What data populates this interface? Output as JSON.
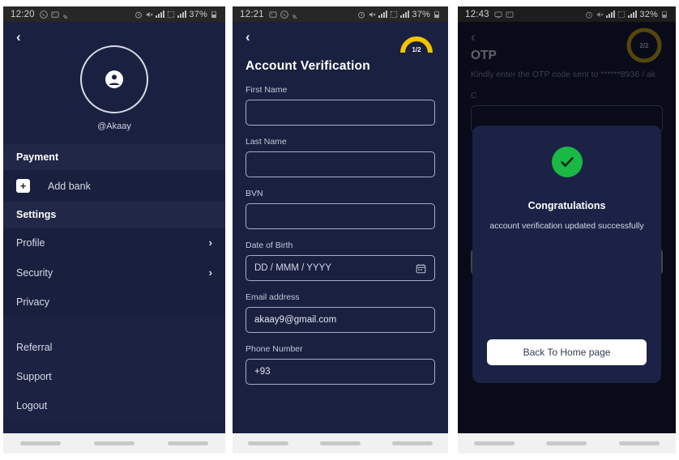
{
  "phone1": {
    "status": {
      "time": "12:20",
      "battery": "37%",
      "left_icons": [
        "whatsapp-icon",
        "image-icon",
        "cast-icon"
      ],
      "right_icons": [
        "alarm-icon",
        "mute-icon",
        "signal-icon",
        "sim-icon",
        "signal-icon"
      ]
    },
    "back_label": "‹",
    "profile": {
      "handle": "@Akaay",
      "avatar_icon": "person-icon"
    },
    "sections": [
      {
        "title": "Payment",
        "items": [
          {
            "label": "Add bank",
            "icon": "plus-icon",
            "chevron": false
          }
        ]
      },
      {
        "title": "Settings",
        "items": [
          {
            "label": "Profile",
            "chevron": true
          },
          {
            "label": "Security",
            "chevron": true
          },
          {
            "label": "Privacy",
            "chevron": false
          }
        ]
      }
    ],
    "footer_items": [
      {
        "label": "Referral"
      },
      {
        "label": "Support"
      },
      {
        "label": "Logout"
      }
    ]
  },
  "phone2": {
    "status": {
      "time": "12:21",
      "battery": "37%"
    },
    "back_label": "‹",
    "progress": {
      "label": "1/2",
      "color": "#f2c300",
      "percent": 50
    },
    "title": "Account Verification",
    "fields": [
      {
        "label": "First Name",
        "value": "",
        "placeholder": ""
      },
      {
        "label": "Last Name",
        "value": "",
        "placeholder": ""
      },
      {
        "label": "BVN",
        "value": "",
        "placeholder": ""
      },
      {
        "label": "Date of Birth",
        "value": "",
        "placeholder": "DD / MMM / YYYY",
        "icon": "calendar-icon"
      },
      {
        "label": "Email address",
        "value": "akaay9@gmail.com",
        "placeholder": ""
      },
      {
        "label": "Phone Number",
        "value": "+93",
        "placeholder": ""
      }
    ]
  },
  "phone3": {
    "status": {
      "time": "12:43",
      "battery": "32%"
    },
    "back_label": "‹",
    "progress": {
      "label": "2/2",
      "color": "#d4aa06",
      "percent": 100
    },
    "title": "OTP",
    "description": "Kindly enter the OTP code sent to ******8936 / ak",
    "sub_label": "C",
    "modal": {
      "icon": "success-check-icon",
      "icon_color": "#1ab845",
      "title": "Congratulations",
      "message": "account verification updated successfully",
      "button_label": "Back To Home page"
    }
  },
  "navbar": {
    "buttons": [
      "recents-button",
      "home-button",
      "back-button"
    ]
  }
}
